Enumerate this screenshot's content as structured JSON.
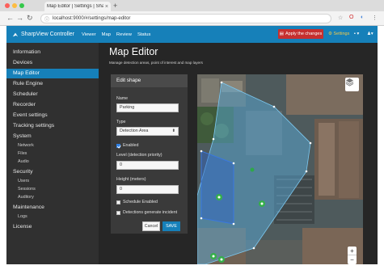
{
  "browser": {
    "tab_title": "Map Editor | Settings | Sharp…",
    "url": "localhost:9000/#/settings/map-editor",
    "icons": [
      "back-icon",
      "forward-icon",
      "reload-icon",
      "info-icon",
      "star-icon",
      "opera-icon",
      "menu-icon"
    ],
    "traffic_lights": [
      "#fc605b",
      "#fdbc40",
      "#34c84a"
    ]
  },
  "app": {
    "brand": "SharpView Controller",
    "nav": [
      "Viewer",
      "Map",
      "Review",
      "Status"
    ],
    "apply_label": "Apply the changes",
    "settings_label": "Settings",
    "accent": "#1680b9",
    "apply_color": "#c62f2f"
  },
  "sidebar": {
    "items": [
      {
        "label": "Information",
        "type": "item"
      },
      {
        "label": "Devices",
        "type": "item"
      },
      {
        "label": "Map Editor",
        "type": "item",
        "active": true
      },
      {
        "label": "Rule Engine",
        "type": "item"
      },
      {
        "label": "Scheduler",
        "type": "item"
      },
      {
        "label": "Recorder",
        "type": "item"
      },
      {
        "label": "Event settings",
        "type": "item"
      },
      {
        "label": "Tracking settings",
        "type": "item"
      },
      {
        "label": "System",
        "type": "item"
      },
      {
        "label": "Network",
        "type": "sub"
      },
      {
        "label": "Files",
        "type": "sub"
      },
      {
        "label": "Audio",
        "type": "sub"
      },
      {
        "label": "Security",
        "type": "item"
      },
      {
        "label": "Users",
        "type": "sub"
      },
      {
        "label": "Sessions",
        "type": "sub"
      },
      {
        "label": "Auditory",
        "type": "sub"
      },
      {
        "label": "Maintenance",
        "type": "item"
      },
      {
        "label": "Logs",
        "type": "sub"
      },
      {
        "label": "License",
        "type": "item"
      }
    ]
  },
  "page": {
    "title": "Map Editor",
    "subtitle": "Manage detection areas, point of interest and map layers"
  },
  "edit_shape": {
    "header": "Edit shape",
    "name_label": "Name",
    "name_value": "Parking",
    "type_label": "Type",
    "type_value": "Detection Area",
    "enabled_label": "Enabled",
    "enabled": true,
    "level_label": "Level (detection priority)",
    "level_value": "0",
    "height_label": "Height (meters)",
    "height_value": "0",
    "schedule_label": "Schedule Enabled",
    "schedule_enabled": false,
    "incident_label": "Detections generate incident",
    "incident_enabled": false,
    "cancel_label": "Cancel",
    "save_label": "SAVE"
  },
  "map": {
    "zoom_in": "+",
    "zoom_out": "−",
    "area_fill": "#5ab4e6",
    "icons": [
      "layers-icon",
      "camera-marker-icon",
      "poi-marker-icon"
    ]
  }
}
